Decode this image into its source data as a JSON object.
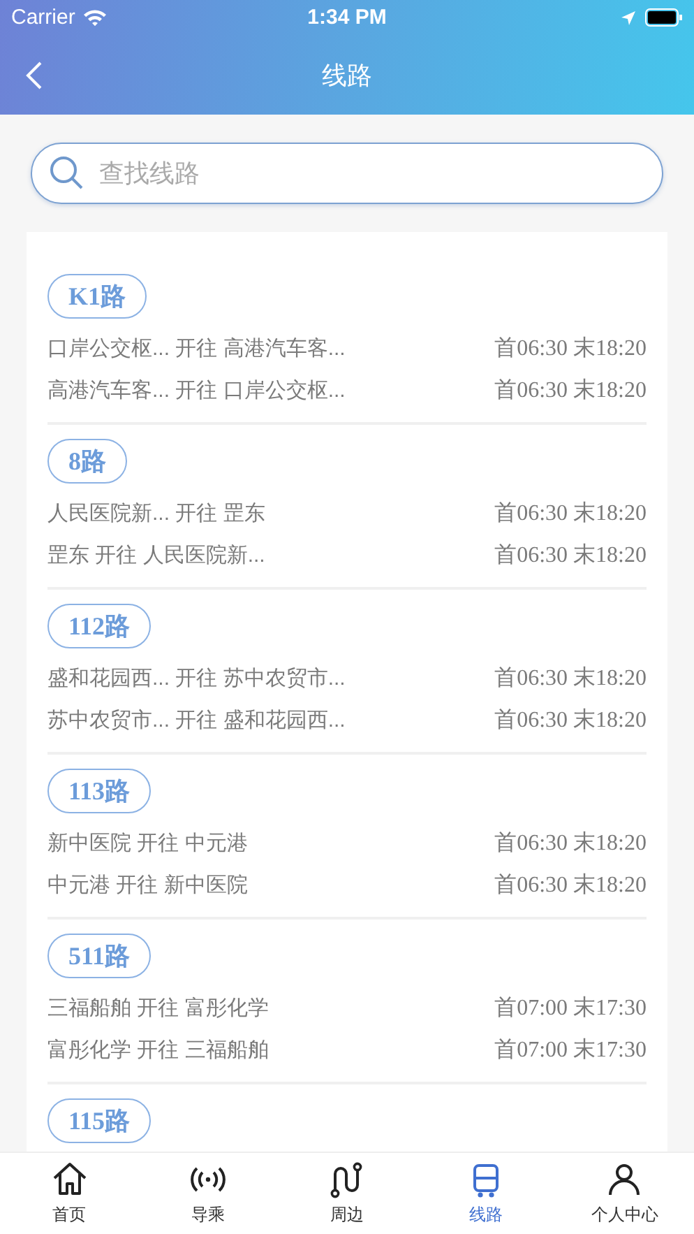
{
  "status_bar": {
    "carrier": "Carrier",
    "time": "1:34 PM"
  },
  "nav_bar": {
    "title": "线路"
  },
  "search": {
    "placeholder": "查找线路"
  },
  "routes": [
    {
      "name": "K1路",
      "directions": [
        {
          "text": "口岸公交枢... 开往 高港汽车客...",
          "times": "首06:30 末18:20"
        },
        {
          "text": "高港汽车客... 开往 口岸公交枢...",
          "times": "首06:30 末18:20"
        }
      ]
    },
    {
      "name": "8路",
      "directions": [
        {
          "text": "人民医院新... 开往 罡东",
          "times": "首06:30 末18:20"
        },
        {
          "text": "罡东 开往 人民医院新...",
          "times": "首06:30 末18:20"
        }
      ]
    },
    {
      "name": "112路",
      "directions": [
        {
          "text": "盛和花园西... 开往 苏中农贸市...",
          "times": "首06:30 末18:20"
        },
        {
          "text": "苏中农贸市... 开往 盛和花园西...",
          "times": "首06:30 末18:20"
        }
      ]
    },
    {
      "name": "113路",
      "directions": [
        {
          "text": "新中医院 开往 中元港",
          "times": "首06:30 末18:20"
        },
        {
          "text": "中元港 开往 新中医院",
          "times": "首06:30 末18:20"
        }
      ]
    },
    {
      "name": "511路",
      "directions": [
        {
          "text": "三福船舶 开往 富彤化学",
          "times": "首07:00 末17:30"
        },
        {
          "text": "富彤化学 开往 三福船舶",
          "times": "首07:00 末17:30"
        }
      ]
    },
    {
      "name": "115路"
    }
  ],
  "tab_bar": [
    {
      "label": "首页",
      "selected": false
    },
    {
      "label": "导乘",
      "selected": false
    },
    {
      "label": "周边",
      "selected": false
    },
    {
      "label": "线路",
      "selected": true
    },
    {
      "label": "个人中心",
      "selected": false
    }
  ]
}
